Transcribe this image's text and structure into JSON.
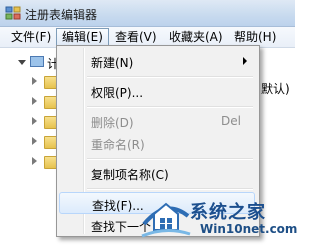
{
  "window": {
    "title": "注册表编辑器"
  },
  "menubar": {
    "items": [
      {
        "label": "文件(F)"
      },
      {
        "label": "编辑(E)"
      },
      {
        "label": "查看(V)"
      },
      {
        "label": "收藏夹(A)"
      },
      {
        "label": "帮助(H)"
      }
    ]
  },
  "tree": {
    "root_label": "计",
    "value_fragment": "默认)"
  },
  "edit_menu": {
    "items": [
      {
        "label": "新建(N)",
        "accelerator": "",
        "submenu": true,
        "disabled": false
      },
      {
        "label": "权限(P)...",
        "accelerator": "",
        "submenu": false,
        "disabled": false
      },
      {
        "label": "删除(D)",
        "accelerator": "Del",
        "submenu": false,
        "disabled": true
      },
      {
        "label": "重命名(R)",
        "accelerator": "",
        "submenu": false,
        "disabled": true
      },
      {
        "label": "复制项名称(C)",
        "accelerator": "",
        "submenu": false,
        "disabled": false
      },
      {
        "label": "查找(F)...",
        "accelerator": "",
        "submenu": false,
        "disabled": false,
        "highlighted": true
      },
      {
        "label": "查找下一个",
        "accelerator": "",
        "submenu": false,
        "disabled": false
      }
    ]
  },
  "watermark": {
    "line1": "系统之家",
    "line2": "Win10net.com"
  }
}
